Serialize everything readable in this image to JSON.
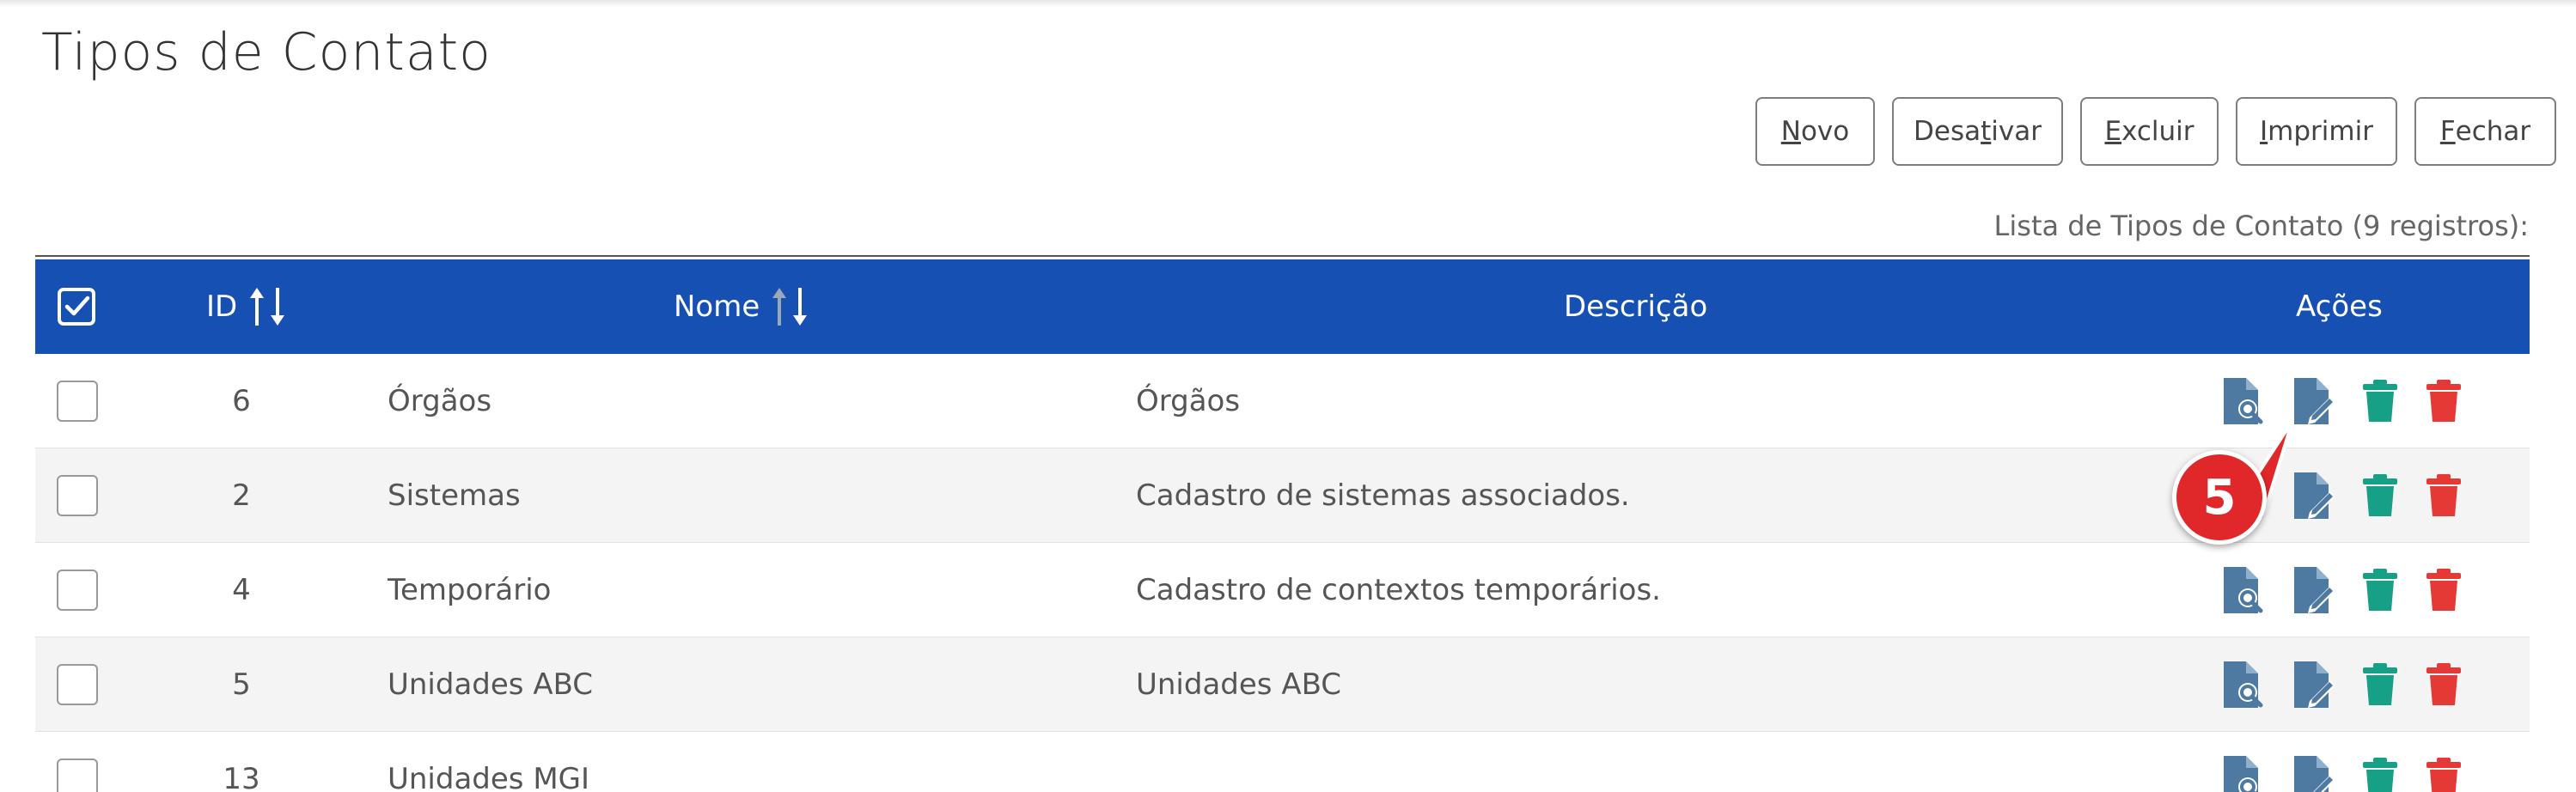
{
  "page": {
    "title": "Tipos de Contato"
  },
  "toolbar": {
    "novo": {
      "pre": "",
      "key": "N",
      "post": "ovo"
    },
    "desativar": {
      "pre": "Desa",
      "key": "t",
      "post": "ivar"
    },
    "excluir": {
      "pre": "",
      "key": "E",
      "post": "xcluir"
    },
    "imprimir": {
      "pre": "",
      "key": "I",
      "post": "mprimir"
    },
    "fechar": {
      "pre": "",
      "key": "F",
      "post": "echar"
    }
  },
  "list": {
    "caption": "Lista de Tipos de Contato (9 registros):",
    "columns": {
      "id": "ID",
      "nome": "Nome",
      "descricao": "Descrição",
      "acoes": "Ações"
    },
    "rows": [
      {
        "id": "6",
        "nome": "Órgãos",
        "descricao": "Órgãos"
      },
      {
        "id": "2",
        "nome": "Sistemas",
        "descricao": "Cadastro de sistemas associados."
      },
      {
        "id": "4",
        "nome": "Temporário",
        "descricao": "Cadastro de contextos temporários."
      },
      {
        "id": "5",
        "nome": "Unidades ABC",
        "descricao": "Unidades ABC"
      },
      {
        "id": "13",
        "nome": "Unidades MGI",
        "descricao": ""
      }
    ]
  },
  "callout": {
    "number": "5"
  },
  "colors": {
    "header": "#1550b2",
    "view_icon": "#4e79a0",
    "edit_icon": "#4e79a0",
    "deactivate_icon": "#16a085",
    "delete_icon": "#e53935",
    "callout": "#e0272a"
  },
  "icons": {
    "view": "file-search-icon",
    "edit": "file-edit-icon",
    "deactivate": "trash-green-icon",
    "delete": "trash-red-icon"
  }
}
